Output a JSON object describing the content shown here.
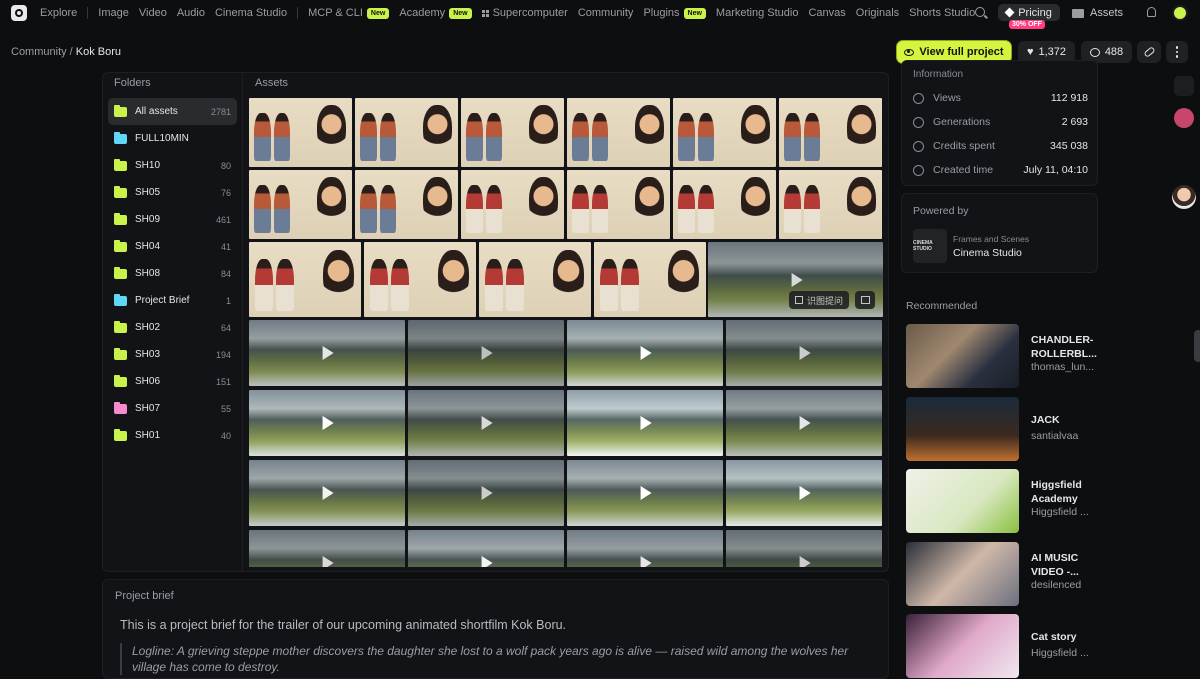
{
  "nav": {
    "items": [
      {
        "label": "Explore",
        "badge": "",
        "sep_after": true
      },
      {
        "label": "Image",
        "badge": ""
      },
      {
        "label": "Video",
        "badge": ""
      },
      {
        "label": "Audio",
        "badge": ""
      },
      {
        "label": "Cinema Studio",
        "badge": "",
        "sep_after": true
      },
      {
        "label": "MCP & CLI",
        "badge": "New"
      },
      {
        "label": "Academy",
        "badge": "New"
      },
      {
        "label": "Supercomputer",
        "badge": "",
        "icon": "grid-icon"
      },
      {
        "label": "Community",
        "badge": ""
      },
      {
        "label": "Plugins",
        "badge": "New"
      },
      {
        "label": "Marketing Studio",
        "badge": ""
      },
      {
        "label": "Canvas",
        "badge": ""
      },
      {
        "label": "Originals",
        "badge": ""
      },
      {
        "label": "Shorts Studio",
        "badge": ""
      }
    ],
    "pricing_label": "Pricing",
    "pricing_badge": "30% OFF",
    "assets_label": "Assets"
  },
  "breadcrumb": {
    "parent": "Community",
    "separator": " / ",
    "current": "Kok Boru"
  },
  "actions": {
    "view_full_label": "View full project",
    "likes": "1,372",
    "comments": "488"
  },
  "folders": {
    "title": "Folders",
    "items": [
      {
        "name": "All assets",
        "count": "2781",
        "color": "#c9f24a",
        "active": true
      },
      {
        "name": "FULL10MIN",
        "count": "",
        "color": "#5fd7f5"
      },
      {
        "name": "SH10",
        "count": "80",
        "color": "#c9f24a"
      },
      {
        "name": "SH05",
        "count": "76",
        "color": "#c9f24a"
      },
      {
        "name": "SH09",
        "count": "461",
        "color": "#c9f24a"
      },
      {
        "name": "SH04",
        "count": "41",
        "color": "#c9f24a"
      },
      {
        "name": "SH08",
        "count": "84",
        "color": "#c9f24a"
      },
      {
        "name": "Project Brief",
        "count": "1",
        "color": "#5fd7f5"
      },
      {
        "name": "SH02",
        "count": "64",
        "color": "#c9f24a"
      },
      {
        "name": "SH03",
        "count": "194",
        "color": "#c9f24a"
      },
      {
        "name": "SH06",
        "count": "151",
        "color": "#c9f24a"
      },
      {
        "name": "SH07",
        "count": "55",
        "color": "#f58ad0"
      },
      {
        "name": "SH01",
        "count": "40",
        "color": "#c9f24a"
      }
    ]
  },
  "assets": {
    "title": "Assets",
    "ocr_label": "识图提问"
  },
  "brief": {
    "title": "Project brief",
    "intro": "This is a project brief for the trailer of our upcoming animated shortfilm Kok Boru.",
    "logline": "Logline: A grieving steppe mother discovers the daughter she lost to a wolf pack years ago is alive — raised wild among the wolves her village has come to destroy."
  },
  "info": {
    "title": "Information",
    "rows": [
      {
        "label": "Views",
        "value": "112 918",
        "icon": "eye-icon"
      },
      {
        "label": "Generations",
        "value": "2 693",
        "icon": "sparkle-icon"
      },
      {
        "label": "Credits spent",
        "value": "345 038",
        "icon": "coin-icon"
      },
      {
        "label": "Created time",
        "value": "July 11, 04:10",
        "icon": "clock-icon"
      }
    ]
  },
  "powered": {
    "title": "Powered by",
    "logo_text": "CINEMA STUDIO",
    "sub": "Frames and Scenes",
    "name": "Cinema Studio"
  },
  "recommended": {
    "title": "Recommended",
    "items": [
      {
        "title": "CHANDLER-\nROLLERBL...",
        "author": "thomas_lun..."
      },
      {
        "title": "JACK",
        "author": "santialvaa"
      },
      {
        "title": "Higgsfield\nAcademy",
        "author": "Higgsfield ..."
      },
      {
        "title": "AI MUSIC\nVIDEO -...",
        "author": "desilenced"
      },
      {
        "title": "Cat story",
        "author": "Higgsfield ..."
      }
    ]
  }
}
